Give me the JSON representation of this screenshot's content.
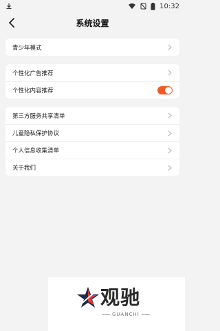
{
  "status_bar": {
    "time": "10:32",
    "icons": [
      "download-icon",
      "wifi-icon",
      "no-sim-icon",
      "battery-icon"
    ]
  },
  "header": {
    "title": "系统设置",
    "back_icon": "chevron-left-icon"
  },
  "cards": [
    {
      "items": [
        {
          "label": "青少年模式",
          "type": "chevron"
        }
      ]
    },
    {
      "items": [
        {
          "label": "个性化广告推荐",
          "type": "chevron"
        },
        {
          "label": "个性化内容推荐",
          "type": "toggle",
          "enabled": true
        }
      ]
    },
    {
      "items": [
        {
          "label": "第三方服务共享清单",
          "type": "chevron"
        },
        {
          "label": "儿童隐私保护协议",
          "type": "chevron"
        },
        {
          "label": "个人信息收集清单",
          "type": "chevron"
        },
        {
          "label": "关于我们",
          "type": "chevron"
        }
      ]
    }
  ],
  "watermark": {
    "text": "观驰",
    "subtext": "GUANCHI"
  },
  "colors": {
    "accent": "#f05a24",
    "background": "#f3f3f3",
    "card": "#ffffff"
  }
}
